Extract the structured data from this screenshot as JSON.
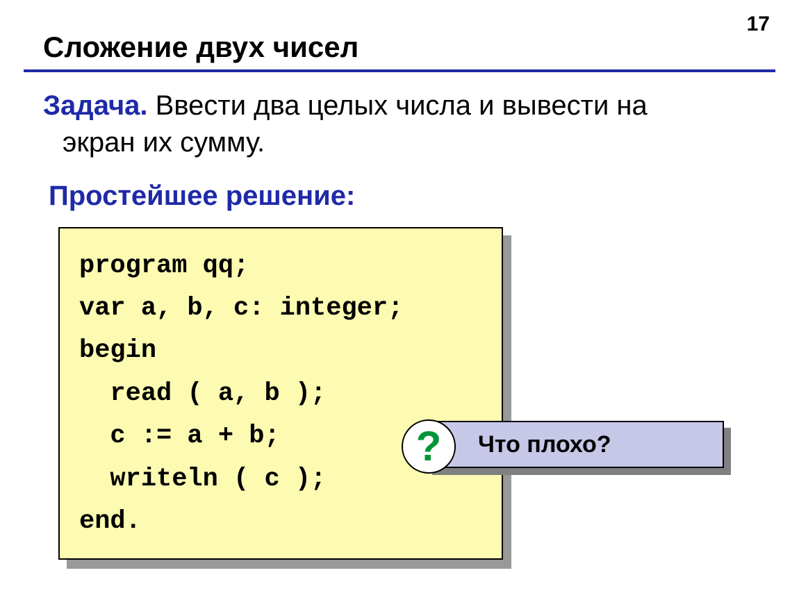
{
  "page_number": "17",
  "title": "Сложение двух чисел",
  "task": {
    "label": "Задача.",
    "line1": " Ввести два целых числа и вывести на",
    "line2": "экран их сумму."
  },
  "solution_label": "Простейшее решение:",
  "code": "program qq;\nvar a, b, c: integer;\nbegin\n  read ( a, b );\n  c := a + b;\n  writeln ( c );\nend.",
  "callout": {
    "mark": "?",
    "text": "Что плохо?"
  }
}
